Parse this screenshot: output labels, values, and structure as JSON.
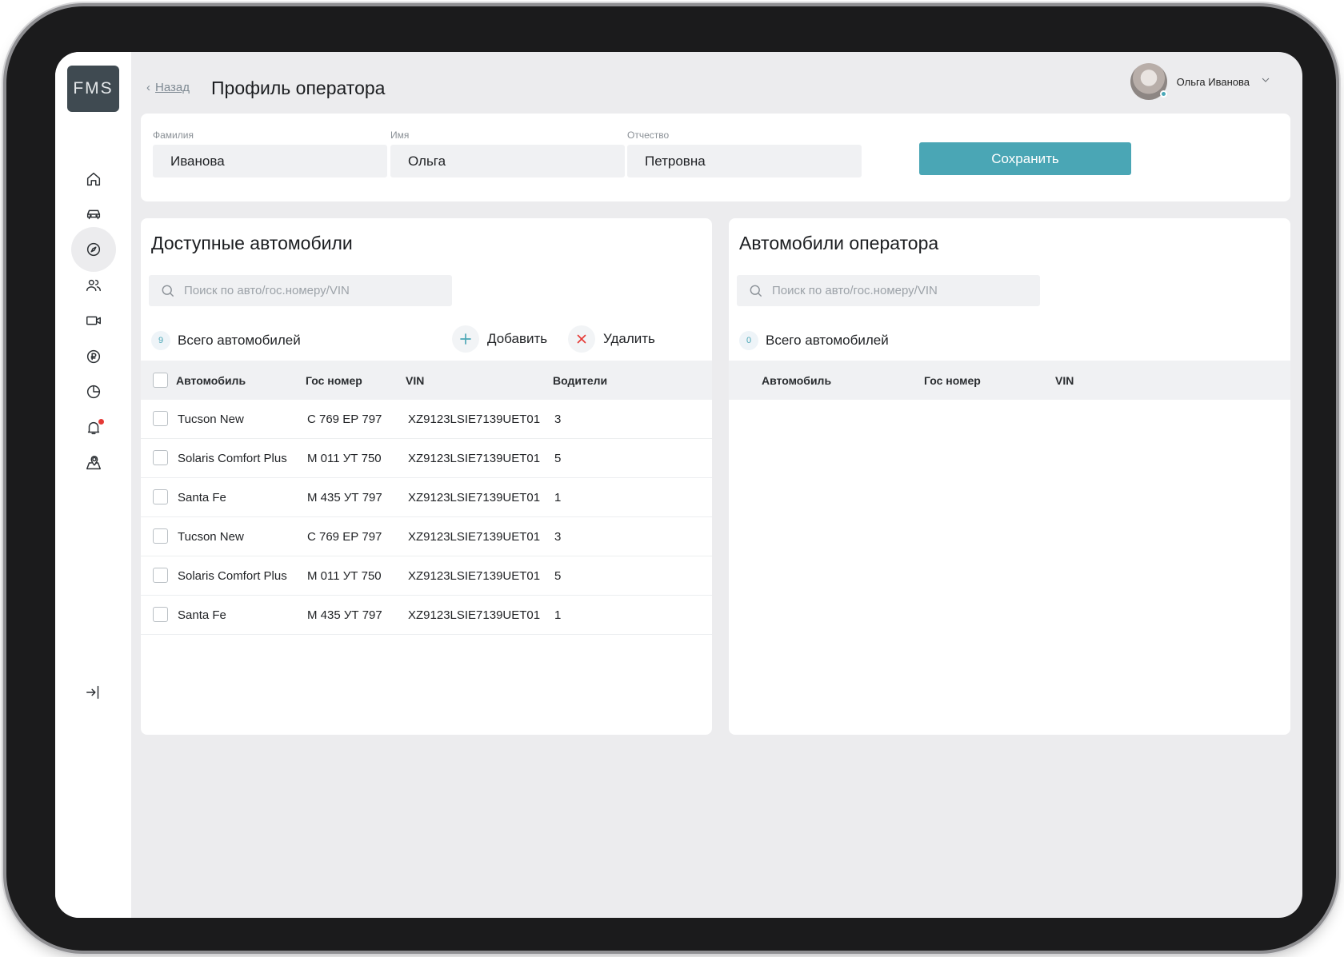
{
  "app": {
    "logo": "FMS"
  },
  "header": {
    "back_label": "Назад",
    "title": "Профиль оператора",
    "user_name": "Ольга  Иванова"
  },
  "form": {
    "surname": {
      "label": "Фамилия",
      "value": "Иванова"
    },
    "name": {
      "label": "Имя",
      "value": "Ольга"
    },
    "patronymic": {
      "label": "Отчество",
      "value": "Петровна"
    },
    "save_label": "Сохранить"
  },
  "available": {
    "title": "Доступные автомобили",
    "search_placeholder": "Поиск по авто/гос.номеру/VIN",
    "count": "9",
    "total_label": "Всего автомобилей",
    "add_label": "Добавить",
    "delete_label": "Удалить",
    "columns": [
      "Автомобиль",
      "Гос номер",
      "VIN",
      "Водители"
    ],
    "rows": [
      {
        "car": "Tucson New",
        "plate": "С 769 ЕР 797",
        "vin": "XZ9123LSIE7139UET01",
        "drivers": "3"
      },
      {
        "car": "Solaris Comfort Plus",
        "plate": "М 011 УТ 750",
        "vin": "XZ9123LSIE7139UET01",
        "drivers": "5"
      },
      {
        "car": "Santa Fe",
        "plate": "М 435 УТ 797",
        "vin": "XZ9123LSIE7139UET01",
        "drivers": "1"
      },
      {
        "car": "Tucson New",
        "plate": "С 769 ЕР 797",
        "vin": "XZ9123LSIE7139UET01",
        "drivers": "3"
      },
      {
        "car": "Solaris Comfort Plus",
        "plate": "М 011 УТ 750",
        "vin": "XZ9123LSIE7139UET01",
        "drivers": "5"
      },
      {
        "car": "Santa Fe",
        "plate": "М 435 УТ 797",
        "vin": "XZ9123LSIE7139UET01",
        "drivers": "1"
      }
    ]
  },
  "operator": {
    "title": "Автомобили оператора",
    "search_placeholder": "Поиск по авто/гос.номеру/VIN",
    "count": "0",
    "total_label": "Всего автомобилей",
    "columns": [
      "Автомобиль",
      "Гос номер",
      "VIN"
    ]
  },
  "sidebar": {
    "items": [
      "home-icon",
      "car-icon",
      "compass-icon",
      "users-icon",
      "video-icon",
      "ruble-icon",
      "pie-chart-icon",
      "bell-icon",
      "map-pin-icon"
    ],
    "active": "compass-icon",
    "logout": "logout-icon"
  },
  "colors": {
    "accent": "#4aa6b5",
    "logo_bg": "#3f4a51",
    "delete": "#e53935",
    "background": "#ececee"
  }
}
